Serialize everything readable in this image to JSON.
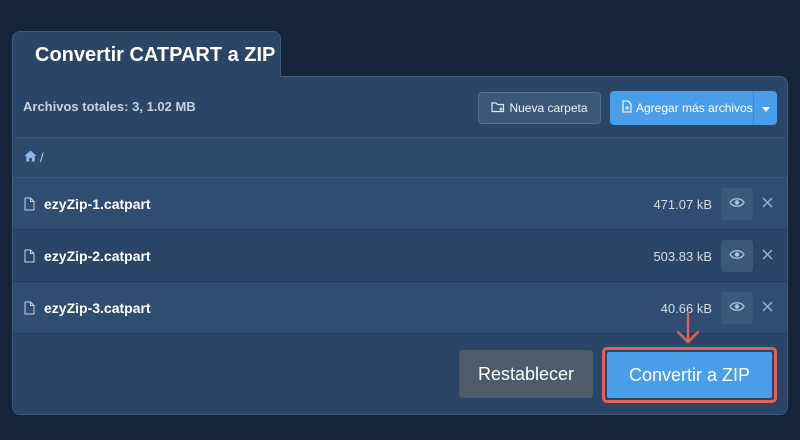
{
  "tab": {
    "title": "Convertir CATPART a ZIP"
  },
  "toolbar": {
    "total_label": "Archivos totales:",
    "total_value": "3, 1.02 MB",
    "new_folder_label": "Nueva carpeta",
    "add_files_label": "Agregar más archivos"
  },
  "breadcrumb": {
    "separator": "/"
  },
  "files": [
    {
      "name": "ezyZip-1.catpart",
      "size": "471.07 kB"
    },
    {
      "name": "ezyZip-2.catpart",
      "size": "503.83 kB"
    },
    {
      "name": "ezyZip-3.catpart",
      "size": "40.66 kB"
    }
  ],
  "actions": {
    "reset_label": "Restablecer",
    "convert_label": "Convertir a ZIP"
  },
  "colors": {
    "background": "#14243a",
    "panel": "#2a4565",
    "primary": "#4a9de8",
    "reset": "#4d5c6d",
    "highlight": "#e0605a"
  },
  "icons": [
    "folder-plus-icon",
    "file-plus-icon",
    "caret-down-icon",
    "home-icon",
    "file-icon",
    "eye-icon",
    "close-icon",
    "arrow-down-icon"
  ]
}
